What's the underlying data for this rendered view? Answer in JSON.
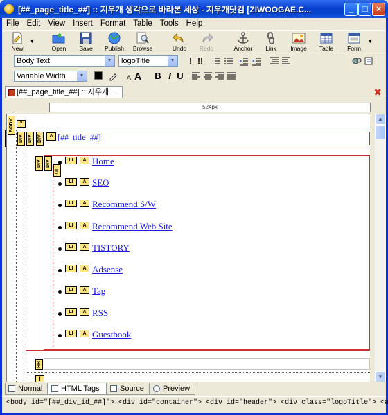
{
  "window": {
    "title": "[##_page_title_##] :: 지우개 생각으로 바라본 세상 - 지우개닷컴 [ZIWOOGAE.C...",
    "minimize": "_",
    "maximize": "□",
    "close": "×"
  },
  "menu": [
    "File",
    "Edit",
    "View",
    "Insert",
    "Format",
    "Table",
    "Tools",
    "Help"
  ],
  "toolbar": [
    {
      "label": "New",
      "icon": "new-doc-icon"
    },
    {
      "label": "Open",
      "icon": "open-folder-icon"
    },
    {
      "label": "Save",
      "icon": "save-disk-icon"
    },
    {
      "label": "Publish",
      "icon": "publish-globe-icon"
    },
    {
      "label": "Browse",
      "icon": "browse-magnifier-icon"
    },
    {
      "label": "Undo",
      "icon": "undo-arrow-icon"
    },
    {
      "label": "Redo",
      "icon": "redo-arrow-icon"
    },
    {
      "label": "Anchor",
      "icon": "anchor-icon"
    },
    {
      "label": "Link",
      "icon": "link-chain-icon"
    },
    {
      "label": "Image",
      "icon": "image-icon"
    },
    {
      "label": "Table",
      "icon": "table-icon"
    },
    {
      "label": "Form",
      "icon": "form-icon"
    }
  ],
  "format": {
    "paragraph_style": "Body Text",
    "css_class": "logoTitle",
    "font": "Variable Width",
    "bold": "B",
    "italic": "I",
    "underline": "U",
    "important1": "!",
    "important2": "!!"
  },
  "document_tab": "[##_page_title_##] :: 지우개 ...",
  "ruler_label": "524px",
  "side_label": "4px",
  "canvas": {
    "body_tag": "BODY",
    "unknown_tag": "?",
    "div_tag": "DIV",
    "a_tag": "A",
    "li_tag": "LI",
    "ul_tag": "UL",
    "hr_tag": "HR",
    "title_link": "[##_title_##]",
    "items": [
      "Home",
      "SEO",
      "Recommend S/W",
      "Recommend Web Site",
      "TISTORY",
      "Adsense",
      "Tag",
      "RSS",
      "Guestbook"
    ],
    "bottom_tag": "!"
  },
  "bottom_tabs": [
    "Normal",
    "HTML Tags",
    "Source",
    "Preview"
  ],
  "status": "<body id=\"[##_div_id_##]\">  <div id=\"container\">  <div id=\"header\">  <div class=\"logoTitle\">  <a>"
}
